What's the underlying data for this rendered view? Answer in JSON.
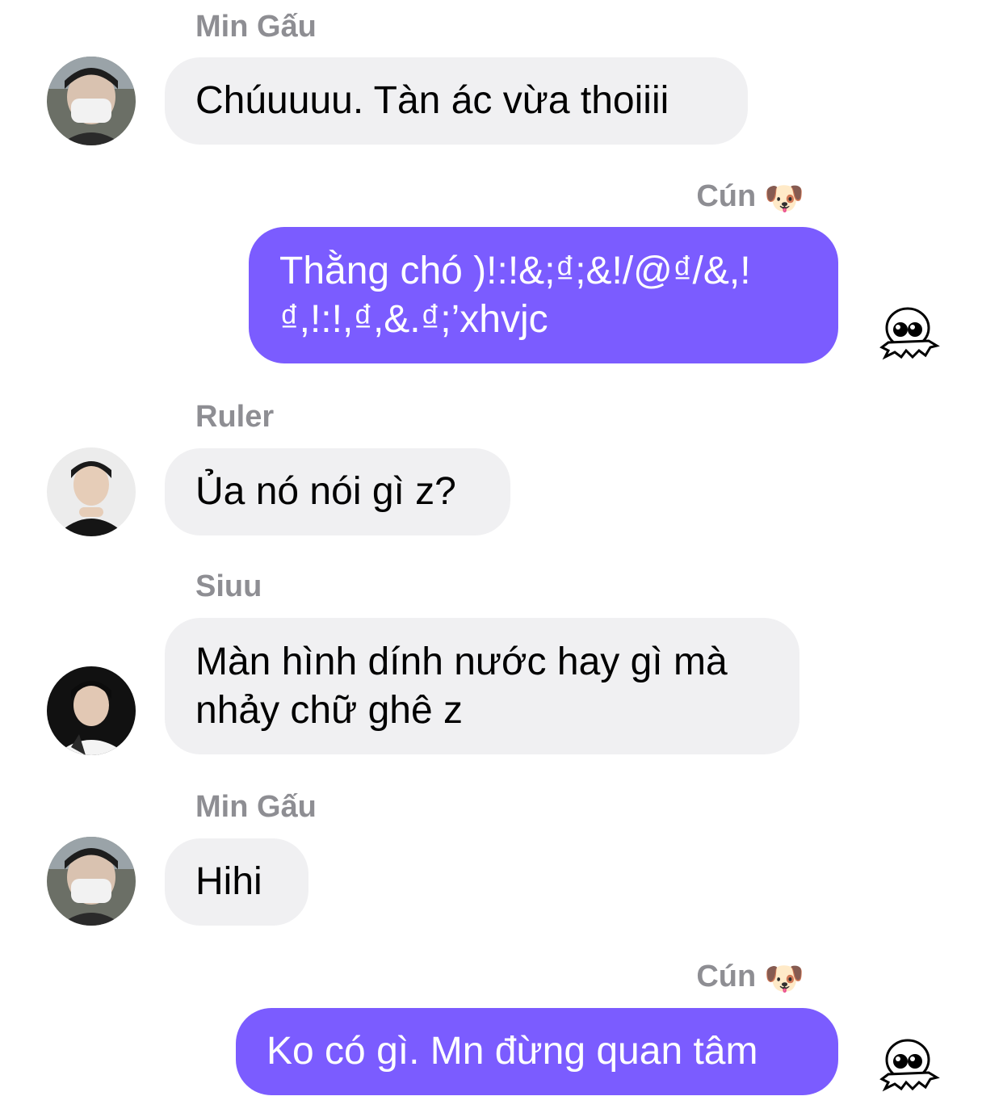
{
  "colors": {
    "incoming_bubble": "#f0f0f2",
    "outgoing_bubble": "#7b5cff",
    "sender_name": "#8e8e93"
  },
  "messages": [
    {
      "sender": "Min Gấu",
      "lines": [
        "Chúuuuu. Tàn ác vừa thoiiii"
      ],
      "direction": "incoming",
      "avatar_icon": "avatar-min-gau"
    },
    {
      "sender": "Cún",
      "sender_emoji": "🐶",
      "lines": [
        "Thằng chó )!:!&;₫;&!/@₫/&,!",
        "₫,!:!,₫,&.₫;’xhvjc"
      ],
      "direction": "outgoing",
      "read_icon": "skull-sticker-icon"
    },
    {
      "sender": "Ruler",
      "lines": [
        "Ủa nó nói gì z?"
      ],
      "direction": "incoming",
      "avatar_icon": "avatar-ruler"
    },
    {
      "sender": "Siuu",
      "lines": [
        "Màn hình dính nước hay gì mà",
        "nhảy chữ ghê z"
      ],
      "direction": "incoming",
      "avatar_icon": "avatar-siuu"
    },
    {
      "sender": "Min Gấu",
      "lines": [
        "Hihi"
      ],
      "direction": "incoming",
      "avatar_icon": "avatar-min-gau"
    },
    {
      "sender": "Cún",
      "sender_emoji": "🐶",
      "lines": [
        "Ko có gì. Mn đừng quan tâm"
      ],
      "direction": "outgoing",
      "read_icon": "skull-sticker-icon"
    }
  ]
}
